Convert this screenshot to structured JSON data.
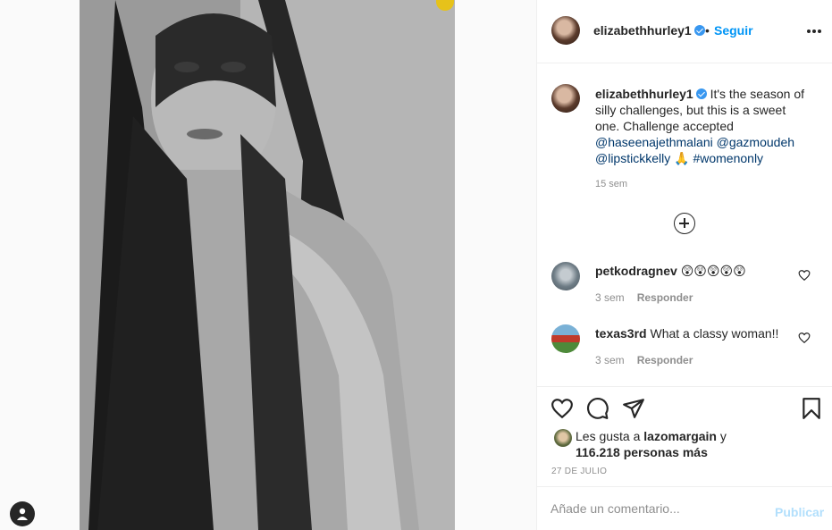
{
  "header": {
    "username": "elizabethhurley1",
    "separator": "•",
    "follow_label": "Seguir"
  },
  "caption": {
    "username": "elizabethhurley1",
    "text": "It's the season of silly challenges, but this is a sweet one. Challenge accepted",
    "mention1": "@haseenajethmalani",
    "mention2": "@gazmoudeh",
    "mention3": "@lipstickkelly",
    "emoji": "🙏",
    "hashtag": "#womenonly",
    "time": "15 sem"
  },
  "comments": [
    {
      "username": "petkodragnev",
      "text": "😲😲😲😲😲",
      "time": "3 sem",
      "reply": "Responder"
    },
    {
      "username": "texas3rd",
      "text": "What a classy woman!!",
      "time": "3 sem",
      "reply": "Responder"
    }
  ],
  "likes": {
    "prefix": "Les gusta a",
    "user": "lazomargain",
    "conj": "y",
    "count": "116.218 personas más"
  },
  "date": "27 DE JULIO",
  "comment_box": {
    "placeholder": "Añade un comentario...",
    "publish_label": "Publicar"
  },
  "colors": {
    "accent": "#0095f6",
    "publish_disabled": "#b2dffc",
    "muted": "#8e8e8e",
    "verified": "#3897f0"
  },
  "icons": [
    "verified-icon",
    "more-options-icon",
    "add-comments-icon",
    "heart-icon",
    "comment-icon",
    "share-icon",
    "bookmark-icon",
    "account-icon"
  ]
}
